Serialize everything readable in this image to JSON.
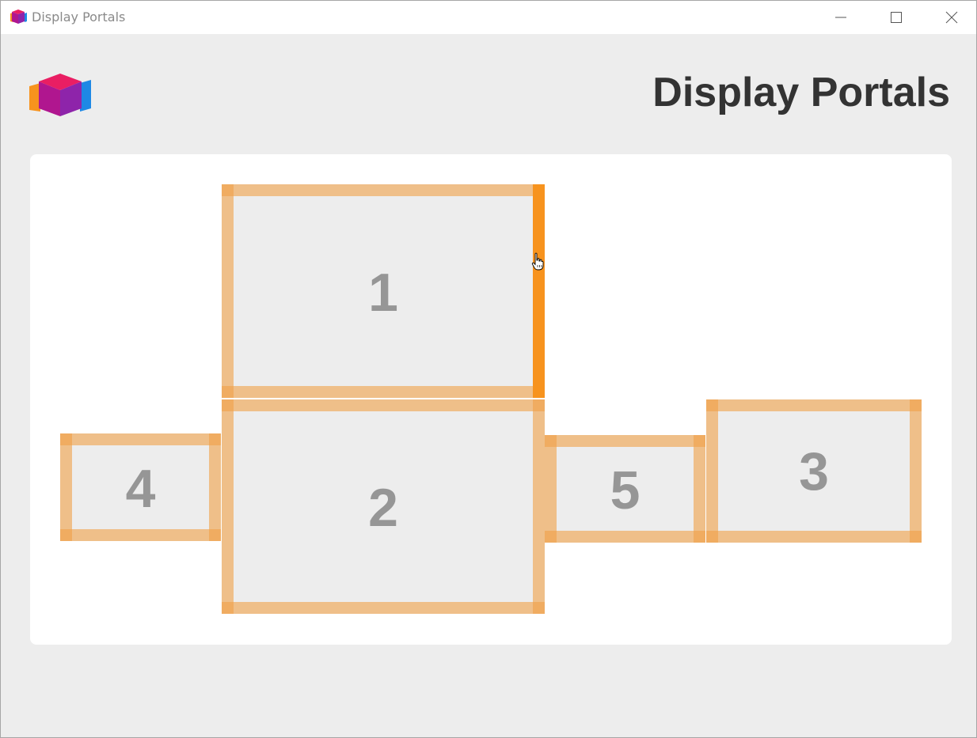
{
  "window": {
    "title": "Display Portals"
  },
  "header": {
    "title": "Display Portals",
    "logo_icon": "cube-logo-icon"
  },
  "colors": {
    "accent": "#f7931e",
    "edge": "#f0a046",
    "display_fill": "#ededed",
    "number": "#969696"
  },
  "displays": [
    {
      "id": "1",
      "label": "1"
    },
    {
      "id": "2",
      "label": "2"
    },
    {
      "id": "3",
      "label": "3"
    },
    {
      "id": "4",
      "label": "4"
    },
    {
      "id": "5",
      "label": "5"
    }
  ]
}
